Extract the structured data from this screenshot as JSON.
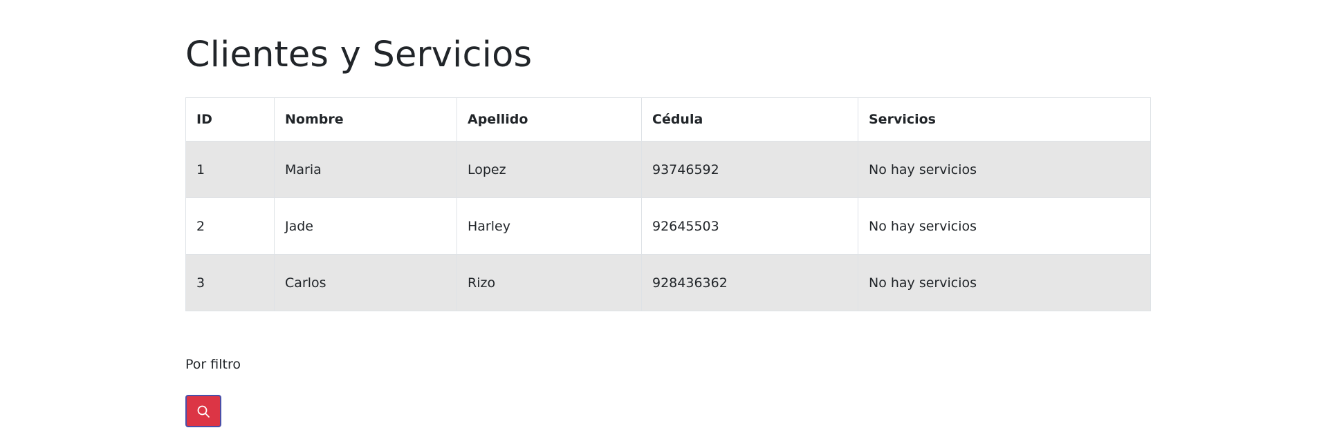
{
  "page": {
    "title": "Clientes y Servicios"
  },
  "table": {
    "headers": {
      "id": "ID",
      "nombre": "Nombre",
      "apellido": "Apellido",
      "cedula": "Cédula",
      "servicios": "Servicios"
    },
    "rows": [
      {
        "id": "1",
        "nombre": "Maria",
        "apellido": "Lopez",
        "cedula": "93746592",
        "servicios": "No hay servicios"
      },
      {
        "id": "2",
        "nombre": "Jade",
        "apellido": "Harley",
        "cedula": "92645503",
        "servicios": "No hay servicios"
      },
      {
        "id": "3",
        "nombre": "Carlos",
        "apellido": "Rizo",
        "cedula": "928436362",
        "servicios": "No hay servicios"
      }
    ]
  },
  "filter": {
    "label": "Por filtro",
    "search_button_icon": "search-icon"
  },
  "colors": {
    "search_button_bg": "#dc3545",
    "striped_row_bg": "#e6e6e6",
    "border": "#dee2e6"
  }
}
